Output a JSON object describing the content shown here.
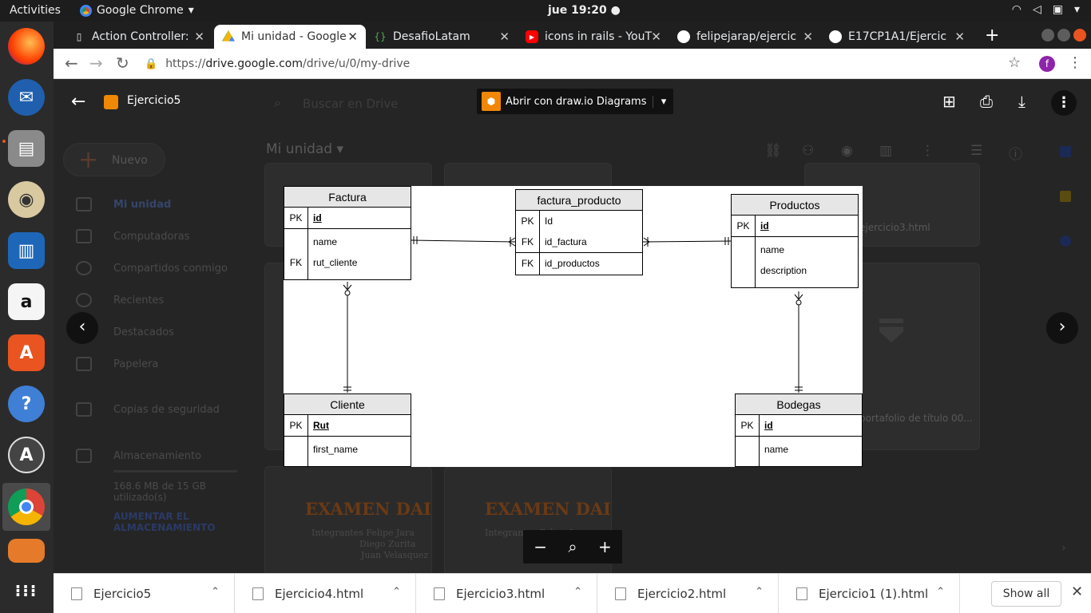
{
  "os": {
    "activities": "Activities",
    "app_menu": "Google Chrome",
    "clock": "jue 19:20"
  },
  "browser": {
    "tabs": [
      {
        "label": "Action Controller:",
        "icon": "doc-icon"
      },
      {
        "label": "Mi unidad - Google",
        "icon": "drive-icon"
      },
      {
        "label": "DesafioLatam",
        "icon": "braces-icon"
      },
      {
        "label": "icons in rails - YouT",
        "icon": "youtube-icon"
      },
      {
        "label": "felipejarap/ejercic",
        "icon": "github-icon"
      },
      {
        "label": "E17CP1A1/Ejercic",
        "icon": "github-icon"
      }
    ],
    "url_scheme": "https://",
    "url_host": "drive.google.com",
    "url_path": "/drive/u/0/my-drive",
    "profile_initial": "f"
  },
  "drive": {
    "new_button": "Nuevo",
    "search_placeholder": "Buscar en Drive",
    "section_title": "Mi unidad",
    "sidebar": [
      {
        "label": "Mi unidad"
      },
      {
        "label": "Computadoras"
      },
      {
        "label": "Compartidos conmigo"
      },
      {
        "label": "Recientes"
      },
      {
        "label": "Destacados"
      },
      {
        "label": "Papelera"
      },
      {
        "label": "Copias de seguridad"
      },
      {
        "label": "Almacenamiento"
      }
    ],
    "storage_used": "168.6 MB de 15 GB utilizado(s)",
    "storage_upgrade": "AUMENTAR EL ALMACENAMIENTO",
    "cards": {
      "file3": "ejercicio3.html",
      "portfolio": "portafolio de título 00...",
      "exam_title": "EXAMEN DAI",
      "exam_authors": [
        "Integrantes Felipe Jara",
        "Diego Zurita",
        "Juan Velasquez"
      ]
    }
  },
  "viewer": {
    "file_name": "Ejercicio5",
    "open_with": "Abrir con draw.io Diagrams"
  },
  "diagram": {
    "entities": {
      "factura": {
        "title": "Factura",
        "rows": [
          {
            "key": "PK",
            "name": "id"
          },
          {
            "key": "",
            "name": "name"
          },
          {
            "key": "FK",
            "name": "rut_cliente"
          }
        ]
      },
      "factura_producto": {
        "title": "factura_producto",
        "rows": [
          {
            "key": "PK",
            "name": "Id"
          },
          {
            "key": "FK",
            "name": "id_factura"
          },
          {
            "key": "FK",
            "name": "id_productos"
          }
        ]
      },
      "productos": {
        "title": "Productos",
        "rows": [
          {
            "key": "PK",
            "name": "id"
          },
          {
            "key": "",
            "name": "name"
          },
          {
            "key": "",
            "name": "description"
          }
        ]
      },
      "cliente": {
        "title": "Cliente",
        "rows": [
          {
            "key": "PK",
            "name": "Rut"
          },
          {
            "key": "",
            "name": "first_name"
          }
        ]
      },
      "bodegas": {
        "title": "Bodegas",
        "rows": [
          {
            "key": "PK",
            "name": "id"
          },
          {
            "key": "",
            "name": "name"
          }
        ]
      }
    }
  },
  "downloads": [
    {
      "name": "Ejercicio5"
    },
    {
      "name": "Ejercicio4.html"
    },
    {
      "name": "Ejercicio3.html"
    },
    {
      "name": "Ejercicio2.html"
    },
    {
      "name": "Ejercicio1 (1).html"
    }
  ],
  "shelf": {
    "show_all": "Show all"
  }
}
